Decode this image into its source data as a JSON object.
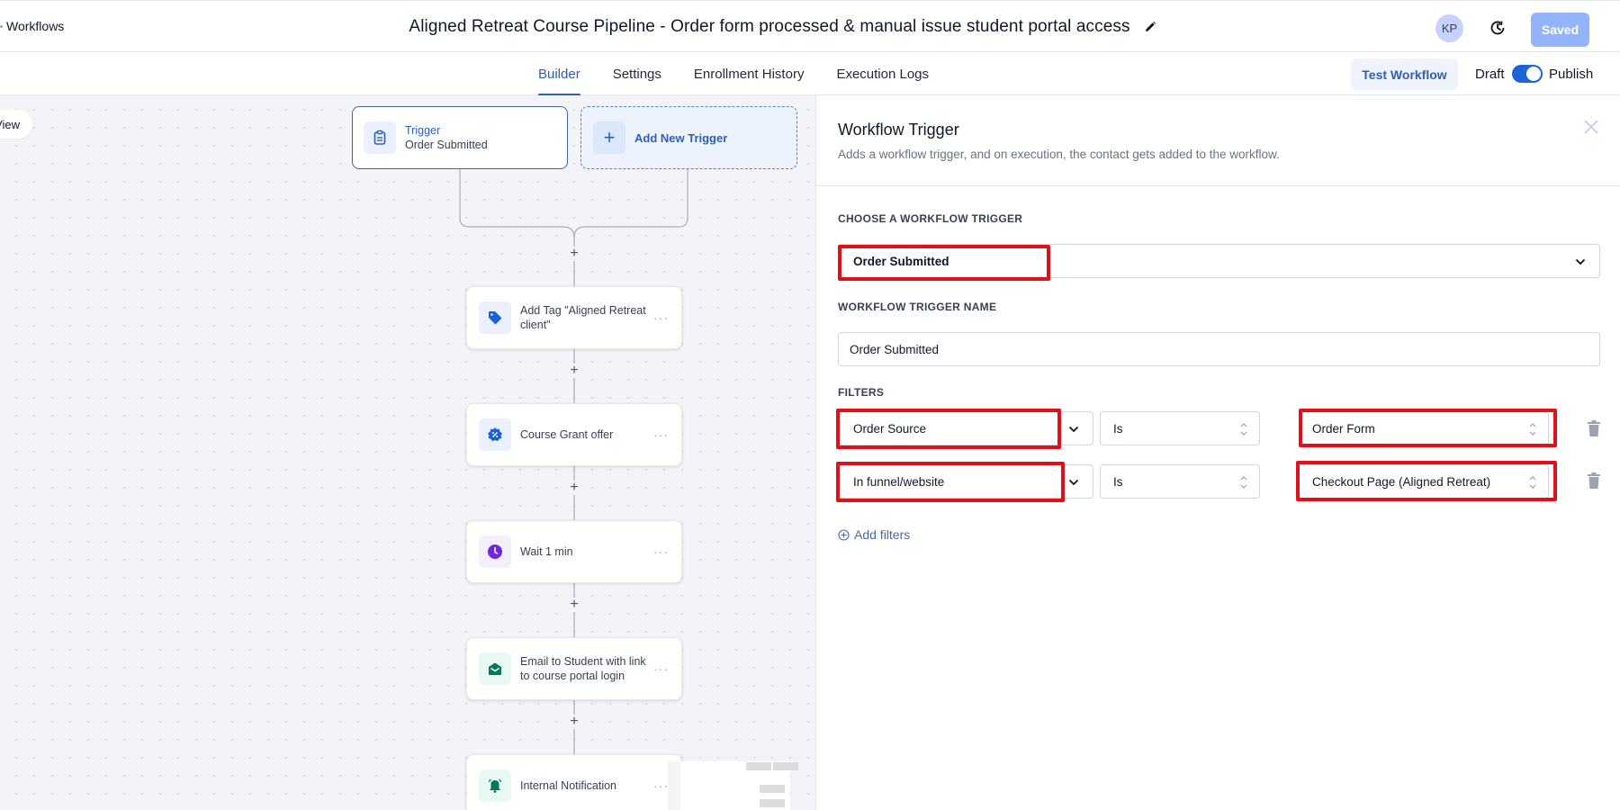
{
  "header": {
    "back_label": "Workflows",
    "workflow_title": "Aligned Retreat Course Pipeline - Order form processed & manual issue student portal access",
    "avatar_initials": "KP",
    "saved_label": "Saved"
  },
  "tabs": [
    {
      "label": "Builder",
      "active": true
    },
    {
      "label": "Settings",
      "active": false
    },
    {
      "label": "Enrollment History",
      "active": false
    },
    {
      "label": "Execution Logs",
      "active": false
    }
  ],
  "toolbar": {
    "test_workflow_label": "Test Workflow",
    "draft_label": "Draft",
    "publish_label": "Publish",
    "publish_toggle_on": true
  },
  "canvas": {
    "view_label": "View",
    "trigger": {
      "title": "Trigger",
      "subtitle": "Order Submitted"
    },
    "add_trigger_label": "Add New Trigger",
    "actions": [
      {
        "label": "Add Tag \"Aligned Retreat client\"",
        "icon": "tag-icon",
        "more": "···"
      },
      {
        "label": "Course Grant offer",
        "icon": "discount-badge-icon",
        "more": "···"
      },
      {
        "label": "Wait 1 min",
        "icon": "clock-icon",
        "more": "···"
      },
      {
        "label": "Email to Student with link to course portal login",
        "icon": "email-open-icon",
        "more": "···"
      },
      {
        "label": "Internal Notification",
        "icon": "bell-icon",
        "more": "···"
      }
    ],
    "add_step_symbol": "+"
  },
  "panel": {
    "title": "Workflow Trigger",
    "description": "Adds a workflow trigger, and on execution, the contact gets added to the workflow.",
    "choose_trigger_label": "CHOOSE A WORKFLOW TRIGGER",
    "selected_trigger": "Order Submitted",
    "trigger_name_label": "WORKFLOW TRIGGER NAME",
    "trigger_name_value": "Order Submitted",
    "filters_label": "FILTERS",
    "filters": [
      {
        "field": "Order Source",
        "operator": "Is",
        "value": "Order Form"
      },
      {
        "field": "In funnel/website",
        "operator": "Is",
        "value": "Checkout Page (Aligned Retreat)"
      }
    ],
    "add_filters_label": "Add filters"
  },
  "colors": {
    "accent": "#2e5fb8",
    "toggle_on": "#1d64d8",
    "saved_button": "#93b4f8",
    "highlight_red": "#e0101a",
    "canvas_bg": "#f3f4f7"
  }
}
